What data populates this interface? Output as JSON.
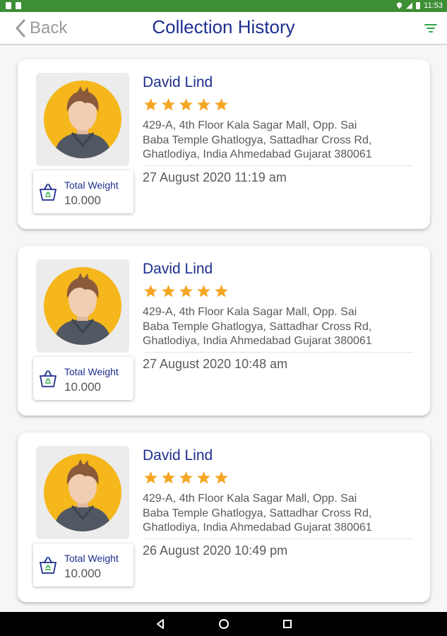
{
  "status_bar": {
    "time": "11:53"
  },
  "header": {
    "back_label": "Back",
    "title": "Collection History"
  },
  "weight_label": "Total Weight",
  "records": [
    {
      "name": "David Lind",
      "rating": 5,
      "address": "429-A, 4th Floor Kala Sagar Mall,  Opp. Sai\nBaba Temple Ghatlogya,  Sattadhar Cross Rd,\nGhatlodiya,  India Ahmedabad Gujarat 380061",
      "date": "27 August 2020 11:19 am",
      "total_weight": "10.000"
    },
    {
      "name": "David Lind",
      "rating": 5,
      "address": "429-A, 4th Floor Kala Sagar Mall,  Opp. Sai\nBaba Temple Ghatlogya,  Sattadhar Cross Rd,\nGhatlodiya,  India Ahmedabad Gujarat 380061",
      "date": "27 August 2020 10:48 am",
      "total_weight": "10.000"
    },
    {
      "name": "David Lind",
      "rating": 5,
      "address": "429-A, 4th Floor Kala Sagar Mall,  Opp. Sai\nBaba Temple Ghatlogya,  Sattadhar Cross Rd,\nGhatlodiya,  India Ahmedabad Gujarat 380061",
      "date": "26 August 2020 10:49 pm",
      "total_weight": "10.000"
    }
  ],
  "colors": {
    "status_bar": "#3e8e35",
    "title": "#1c2e8f",
    "star": "#f5a623",
    "filter_icon": "#2ea84a",
    "avatar_bg": "#f5b71b"
  },
  "icons": [
    "back-chevron-icon",
    "filter-icon",
    "star-icon",
    "basket-icon",
    "avatar-icon",
    "nav-back-icon",
    "nav-home-icon",
    "nav-recents-icon"
  ]
}
